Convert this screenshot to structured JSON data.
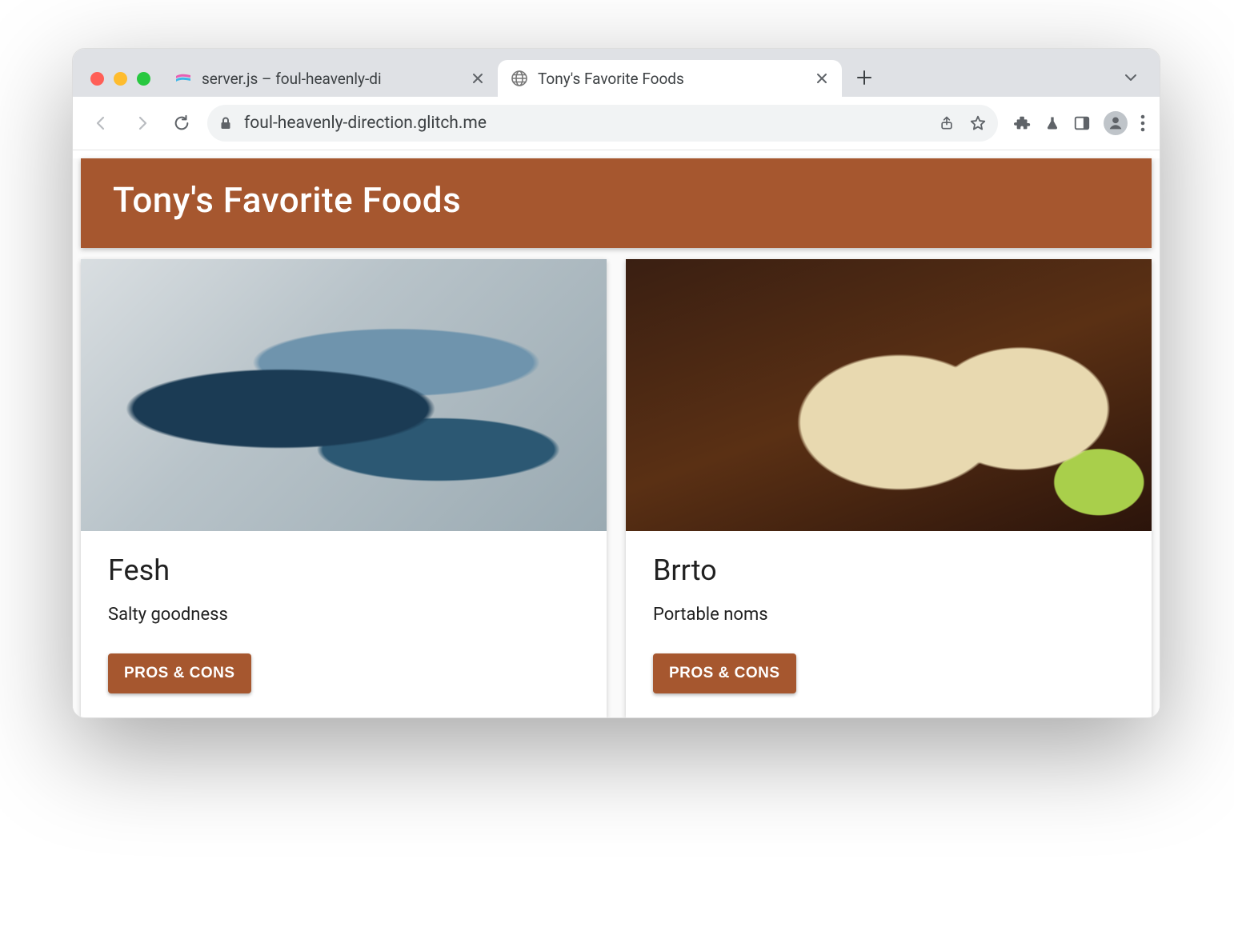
{
  "browser": {
    "tabs": [
      {
        "title": "server.js – foul-heavenly-di",
        "active": false,
        "favicon": "glitch-icon"
      },
      {
        "title": "Tony's Favorite Foods",
        "active": true,
        "favicon": "globe-icon"
      }
    ],
    "url": "foul-heavenly-direction.glitch.me"
  },
  "page": {
    "title": "Tony's Favorite Foods",
    "accent": "#a6572f",
    "cards": [
      {
        "title": "Fesh",
        "subtitle": "Salty goodness",
        "button": "PROS & CONS",
        "image": "fish"
      },
      {
        "title": "Brrto",
        "subtitle": "Portable noms",
        "button": "PROS & CONS",
        "image": "burrito"
      }
    ]
  }
}
